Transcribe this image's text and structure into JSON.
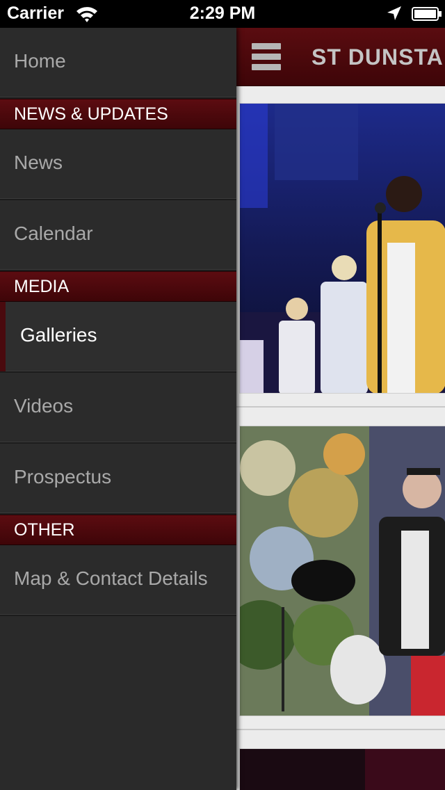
{
  "status_bar": {
    "carrier": "Carrier",
    "time": "2:29 PM"
  },
  "header": {
    "title": "ST DUNSTA"
  },
  "drawer": {
    "items": [
      {
        "type": "item",
        "label": "Home"
      },
      {
        "type": "section",
        "label": "NEWS & UPDATES"
      },
      {
        "type": "item",
        "label": "News"
      },
      {
        "type": "item",
        "label": "Calendar"
      },
      {
        "type": "section",
        "label": "MEDIA"
      },
      {
        "type": "item",
        "label": "Galleries",
        "active": true
      },
      {
        "type": "item",
        "label": "Videos"
      },
      {
        "type": "item",
        "label": "Prospectus"
      },
      {
        "type": "section",
        "label": "OTHER"
      },
      {
        "type": "item",
        "label": "Map & Contact Details"
      }
    ]
  },
  "colors": {
    "accent": "#4a0a0e",
    "drawer_bg": "#2b2b2b",
    "item_text": "#a9a9a9",
    "active_text": "#ffffff"
  },
  "icons": [
    "wifi-icon",
    "location-icon",
    "battery-icon",
    "hamburger-icon"
  ]
}
